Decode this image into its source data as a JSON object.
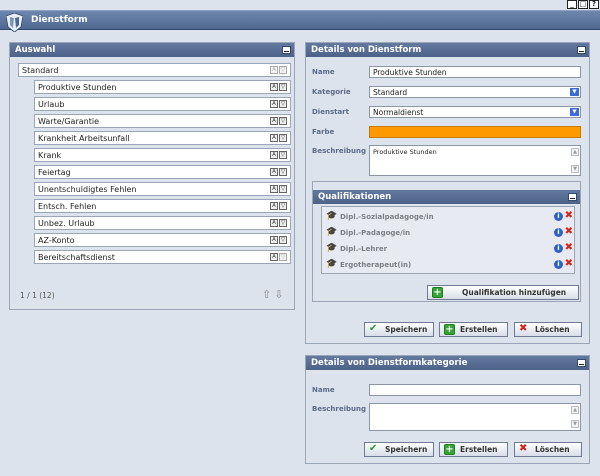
{
  "window": {
    "title": "Dienstform",
    "controls": [
      "_",
      "□",
      "?"
    ]
  },
  "auswahl": {
    "title": "Auswahl",
    "root": "Standard",
    "items": [
      "Produktive Stunden",
      "Urlaub",
      "Warte/Garantie",
      "Krankheit Arbeitsunfall",
      "Krank",
      "Feiertag",
      "Unentschuldigtes Fehlen",
      "Entsch. Fehlen",
      "Unbez. Urlaub",
      "AZ-Konto",
      "Bereitschaftsdienst"
    ],
    "pager": "1 / 1 (12)"
  },
  "details": {
    "title": "Details von Dienstform",
    "labels": {
      "name": "Name",
      "kategorie": "Kategorie",
      "dienstart": "Dienstart",
      "farbe": "Farbe",
      "beschreibung": "Beschreibung"
    },
    "values": {
      "name": "Produktive Stunden",
      "kategorie": "Standard",
      "dienstart": "Normaldienst",
      "farbe": "#ff9900",
      "beschreibung": "Produktive Stunden"
    },
    "qualifikationen": {
      "title": "Qualifikationen",
      "items": [
        "Dipl.-Sozialpadagoge/in",
        "Dipl.-Padagoge/in",
        "Dipl.-Lehrer",
        "Ergotherapeut(in)"
      ],
      "add_label": "Qualifikation hinzufügen"
    },
    "buttons": {
      "save": "Speichern",
      "create": "Erstellen",
      "delete": "Löschen"
    }
  },
  "kategorie": {
    "title": "Details von Dienstformkategorie",
    "labels": {
      "name": "Name",
      "beschreibung": "Beschreibung"
    },
    "values": {
      "name": "",
      "beschreibung": ""
    },
    "buttons": {
      "save": "Speichern",
      "create": "Erstellen",
      "delete": "Löschen"
    }
  }
}
